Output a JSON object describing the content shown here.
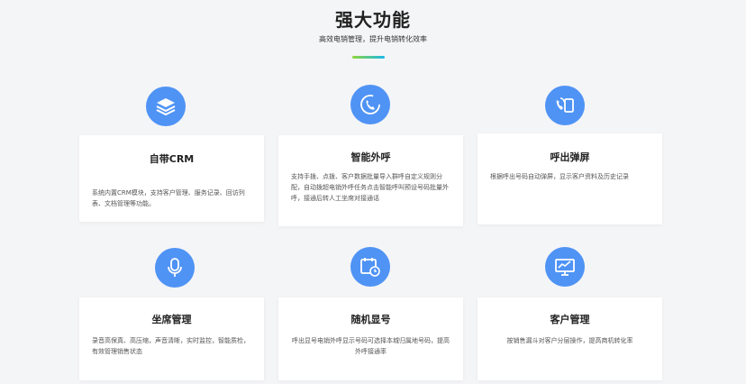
{
  "header": {
    "title": "强大功能",
    "subtitle": "高效电销管理，提升电销转化效率"
  },
  "features": [
    {
      "title": "自带CRM",
      "desc": "系统内置CRM模块，支持客户管理、服务记录、回访列表、文档管理等功能。",
      "icon": "stack-layers-icon"
    },
    {
      "title": "智能外呼",
      "desc": "支持手拨、点拨、客户数据批量导入群呼自定义规则分配，自动拨超电销外呼任务点击智能呼叫预设号码批量外呼，接通后转人工坐席对接通话",
      "icon": "phone-refresh-icon"
    },
    {
      "title": "呼出弹屏",
      "desc": "根据呼出号码自动弹屏，显示客户资料及历史记录",
      "icon": "phone-screen-icon"
    },
    {
      "title": "坐席管理",
      "desc": "录音高保真、高压缩，声音清晰，实时监控，智能质检，有效管理销售状态",
      "icon": "microphone-icon"
    },
    {
      "title": "随机显号",
      "desc": "呼出显号电销外呼显示号码可选择本城归属地号码，提高外呼接通率",
      "icon": "calendar-clock-icon"
    },
    {
      "title": "客户管理",
      "desc": "按销售漏斗对客户分层操作，提高商机转化率",
      "icon": "monitor-chart-icon"
    }
  ],
  "colors": {
    "accent": "#4f93f5",
    "divider_start": "#8ed63b",
    "divider_end": "#19b8e8"
  }
}
